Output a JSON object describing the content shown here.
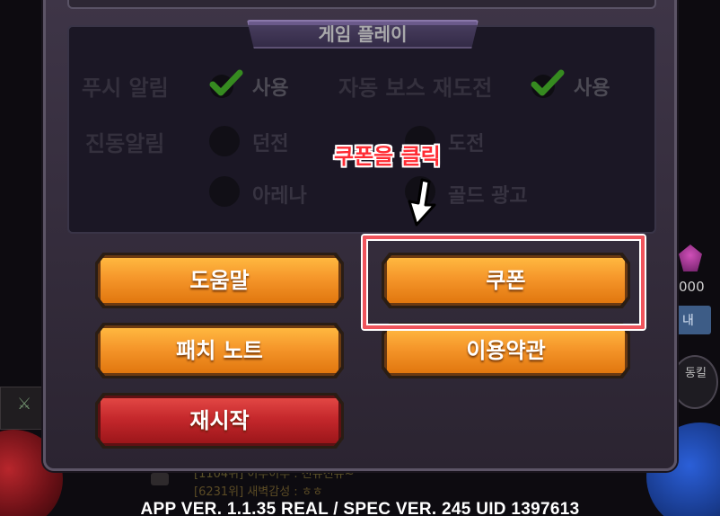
{
  "dialog": {
    "section_title": "게임 플레이",
    "rows": [
      {
        "label": "푸시 알림",
        "options": [
          {
            "label": "사용",
            "state": "checked"
          }
        ]
      },
      {
        "label": "자동 보스 재도전",
        "options": [
          {
            "label": "사용",
            "state": "checked"
          }
        ]
      },
      {
        "label": "진동알림",
        "options": [
          {
            "label": "던전",
            "state": "unchecked"
          },
          {
            "label": "도전",
            "state": "unchecked"
          },
          {
            "label": "아레나",
            "state": "unchecked"
          },
          {
            "label": "골드 광고",
            "state": "unchecked"
          }
        ]
      }
    ],
    "buttons": {
      "help": "도움말",
      "coupon": "쿠폰",
      "patch_notes": "패치 노트",
      "terms": "이용약관",
      "restart": "재시작"
    }
  },
  "annotation": {
    "text": "쿠폰을 클릭",
    "color": "#ff2b33"
  },
  "background": {
    "side_number": "000",
    "side_button": "내",
    "skill_label": "동킬",
    "chat_line_1": "[1104위] 이루이루 : 천유천유~",
    "chat_line_2": "[6231위] 새벽감성 : ㅎㅎ",
    "version_text": "APP VER. 1.1.35 REAL / SPEC VER. 245 UID 1397613"
  },
  "colors": {
    "button_orange": "#f5962a",
    "button_red": "#c5282c",
    "panel": "#2b2431",
    "check_green": "#4fd12a"
  }
}
